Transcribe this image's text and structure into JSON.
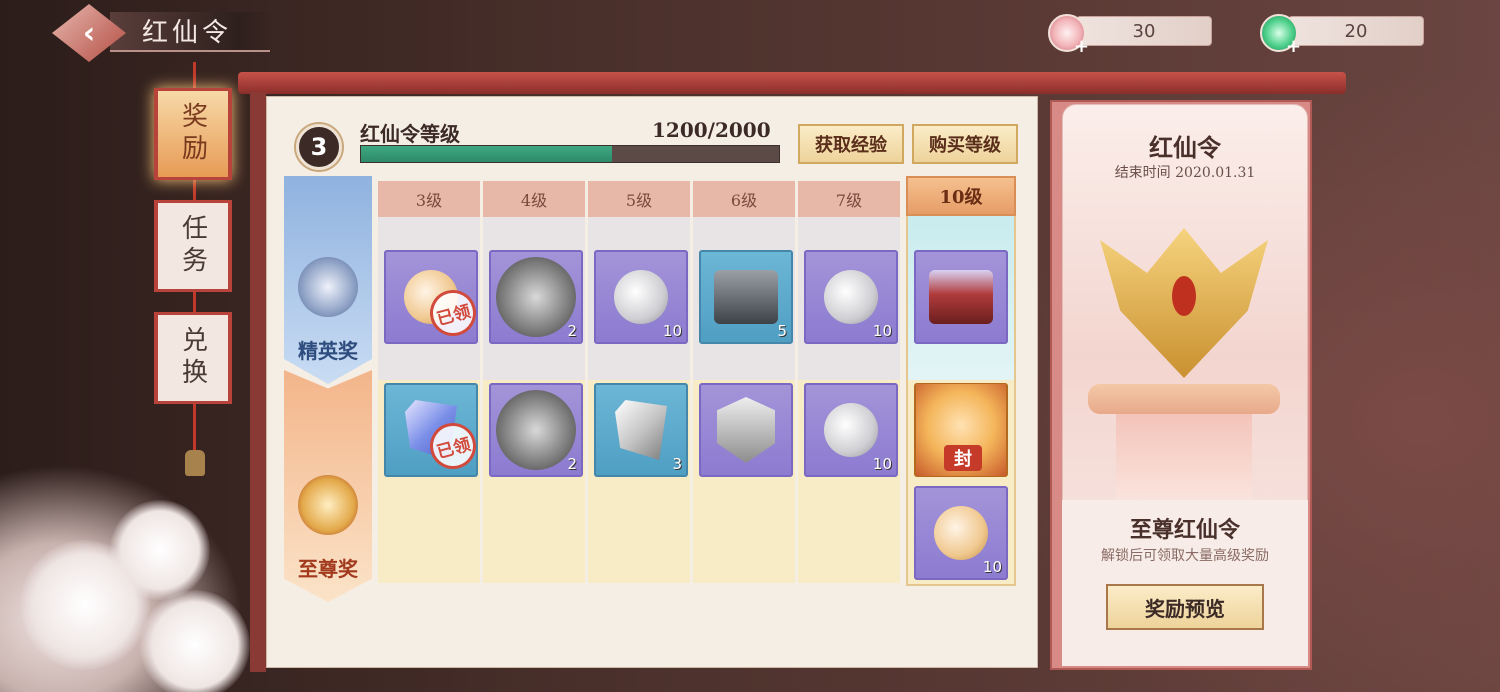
{
  "header": {
    "title": "红仙令",
    "back_icon": "chevron-left-icon",
    "currencies": [
      {
        "name": "pink-flower-coin-icon",
        "value": "30"
      },
      {
        "name": "green-jade-icon",
        "value": "20"
      }
    ]
  },
  "nav": {
    "tabs": [
      {
        "label": "奖励",
        "active": true
      },
      {
        "label": "任务",
        "active": false
      },
      {
        "label": "兑换",
        "active": false
      }
    ]
  },
  "level": {
    "number": "3",
    "label": "红仙令等级",
    "exp": "1200/2000",
    "progress": 0.6
  },
  "actions": {
    "get_exp": "获取经验",
    "buy_level": "购买等级"
  },
  "rows": {
    "elite": "精英奖",
    "supreme": "至尊奖"
  },
  "columns": [
    "3级",
    "4级",
    "5级",
    "6级",
    "7级",
    "10级"
  ],
  "elite_items": [
    {
      "icon": "flower-coin-icon",
      "qty": "",
      "claimed": "已领"
    },
    {
      "icon": "character-group-icon",
      "qty": "2",
      "claimed": ""
    },
    {
      "icon": "silver-coin-icon",
      "qty": "10",
      "claimed": ""
    },
    {
      "icon": "treasure-chest-icon",
      "qty": "5",
      "claimed": ""
    },
    {
      "icon": "silver-coin-icon",
      "qty": "10",
      "claimed": ""
    },
    {
      "icon": "gift-chest-icon",
      "qty": "",
      "claimed": ""
    }
  ],
  "supreme_items": [
    {
      "icon": "blue-gem-icon",
      "qty": "",
      "claimed": "已领"
    },
    {
      "icon": "character-group-icon",
      "qty": "2",
      "claimed": ""
    },
    {
      "icon": "silver-gem-icon",
      "qty": "3",
      "claimed": ""
    },
    {
      "icon": "emblem-shield-icon",
      "qty": "",
      "claimed": ""
    },
    {
      "icon": "silver-coin-icon",
      "qty": "10",
      "claimed": ""
    },
    {
      "icon": "fox-girl-portrait",
      "qty": "",
      "seal": "封"
    },
    {
      "icon": "flower-coin-icon",
      "qty": "10",
      "claimed": ""
    }
  ],
  "side_panel": {
    "title": "红仙令",
    "end_time": "结束时间 2020.01.31",
    "emblem_icon": "golden-fox-mask-icon",
    "subtitle": "至尊红仙令",
    "description": "解锁后可领取大量高级奖励",
    "preview_button": "奖励预览"
  }
}
